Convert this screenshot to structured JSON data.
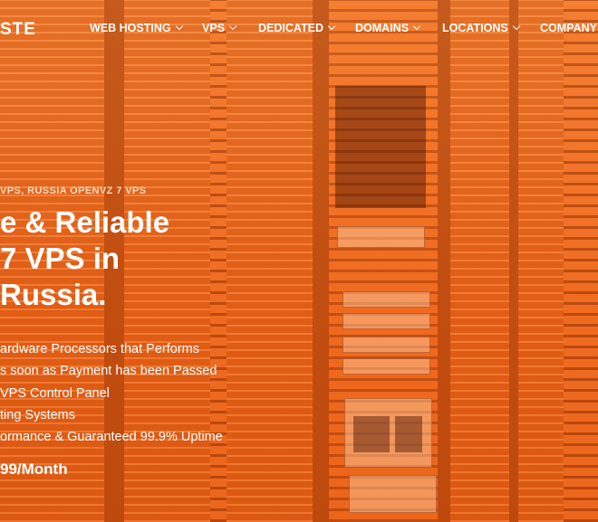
{
  "brand": {
    "logo_text": "STE"
  },
  "nav": {
    "items": [
      {
        "label": "WEB HOSTING"
      },
      {
        "label": "VPS"
      },
      {
        "label": "DEDICATED"
      },
      {
        "label": "DOMAINS"
      },
      {
        "label": "LOCATIONS"
      },
      {
        "label": "COMPANY"
      }
    ]
  },
  "hero": {
    "eyebrow": "VPS, RUSSIA OPENVZ 7 VPS",
    "headline": [
      "e & Reliable",
      "7 VPS in",
      "Russia."
    ],
    "features": [
      "ardware Processors that Performs",
      "s soon as Payment has been Passed",
      "VPS Control Panel",
      "ting Systems",
      "ormance & Guaranteed 99.9% Uptime"
    ],
    "price": "99/Month"
  },
  "theme": {
    "overlay_color": "#f26a1f",
    "text_color": "#ffffff"
  }
}
